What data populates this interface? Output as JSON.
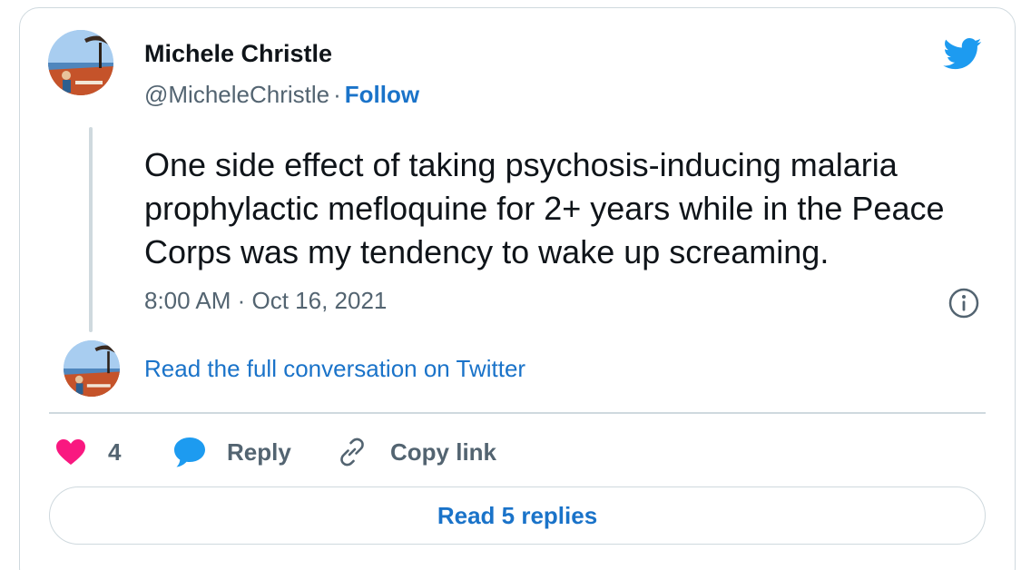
{
  "author": {
    "name": "Michele Christle",
    "handle": "@MicheleChristle",
    "separator": "·",
    "follow_label": "Follow"
  },
  "tweet": {
    "text": "One side effect of taking psychosis-inducing malaria prophylactic mefloquine for 2+ years while in the Peace Corps was my tendency to wake up screaming.",
    "timestamp": "8:00 AM · Oct 16, 2021"
  },
  "thread": {
    "read_conversation_label": "Read the full conversation on Twitter"
  },
  "actions": {
    "like_count": "4",
    "reply_label": "Reply",
    "copy_link_label": "Copy link"
  },
  "footer": {
    "read_replies_label": "Read 5 replies"
  },
  "icons": {
    "brand": "twitter-bird-icon",
    "info": "info-icon",
    "like": "heart-icon",
    "reply": "speech-bubble-icon",
    "copy": "link-icon"
  },
  "colors": {
    "brand": "#1d9bf0",
    "link": "#1a73c9",
    "heart": "#f91880",
    "muted": "#536471",
    "border": "#cfd9de",
    "text": "#0f1419"
  }
}
